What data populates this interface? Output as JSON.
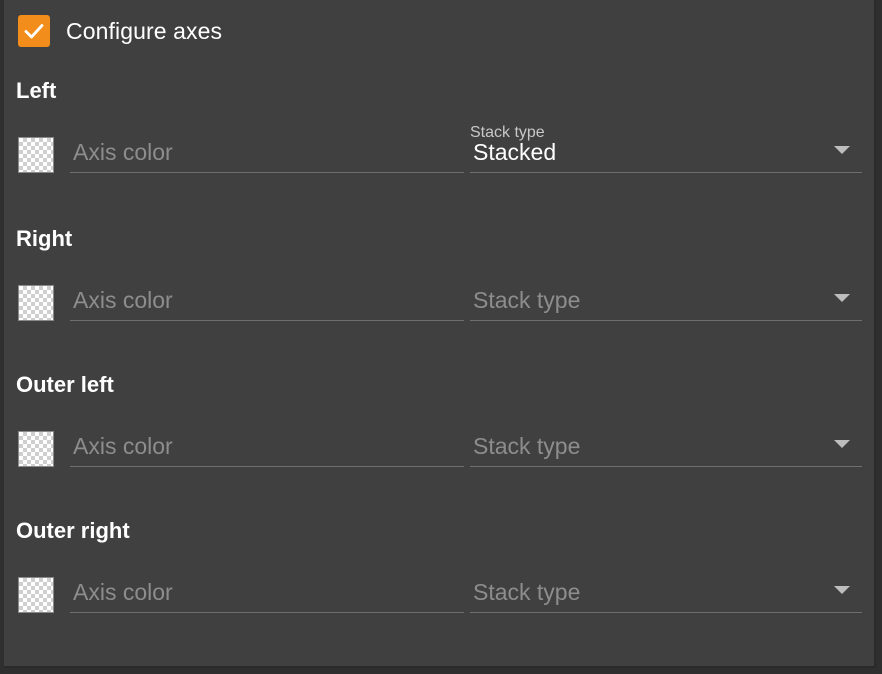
{
  "configure": {
    "label": "Configure axes",
    "checked": true,
    "accent_color": "#f28c1a",
    "icon": "checkmark-icon"
  },
  "axes": [
    {
      "title": "Left",
      "axis_color_placeholder": "Axis color",
      "stack_type_label": "Stack type",
      "stack_type_value": "Stacked",
      "stack_type_placeholder": ""
    },
    {
      "title": "Right",
      "axis_color_placeholder": "Axis color",
      "stack_type_label": "",
      "stack_type_value": "",
      "stack_type_placeholder": "Stack type"
    },
    {
      "title": "Outer left",
      "axis_color_placeholder": "Axis color",
      "stack_type_label": "",
      "stack_type_value": "",
      "stack_type_placeholder": "Stack type"
    },
    {
      "title": "Outer right",
      "axis_color_placeholder": "Axis color",
      "stack_type_label": "",
      "stack_type_value": "",
      "stack_type_placeholder": "Stack type"
    }
  ],
  "icons": {
    "swatch": "transparent-color-swatch",
    "dropdown": "caret-down-icon"
  }
}
